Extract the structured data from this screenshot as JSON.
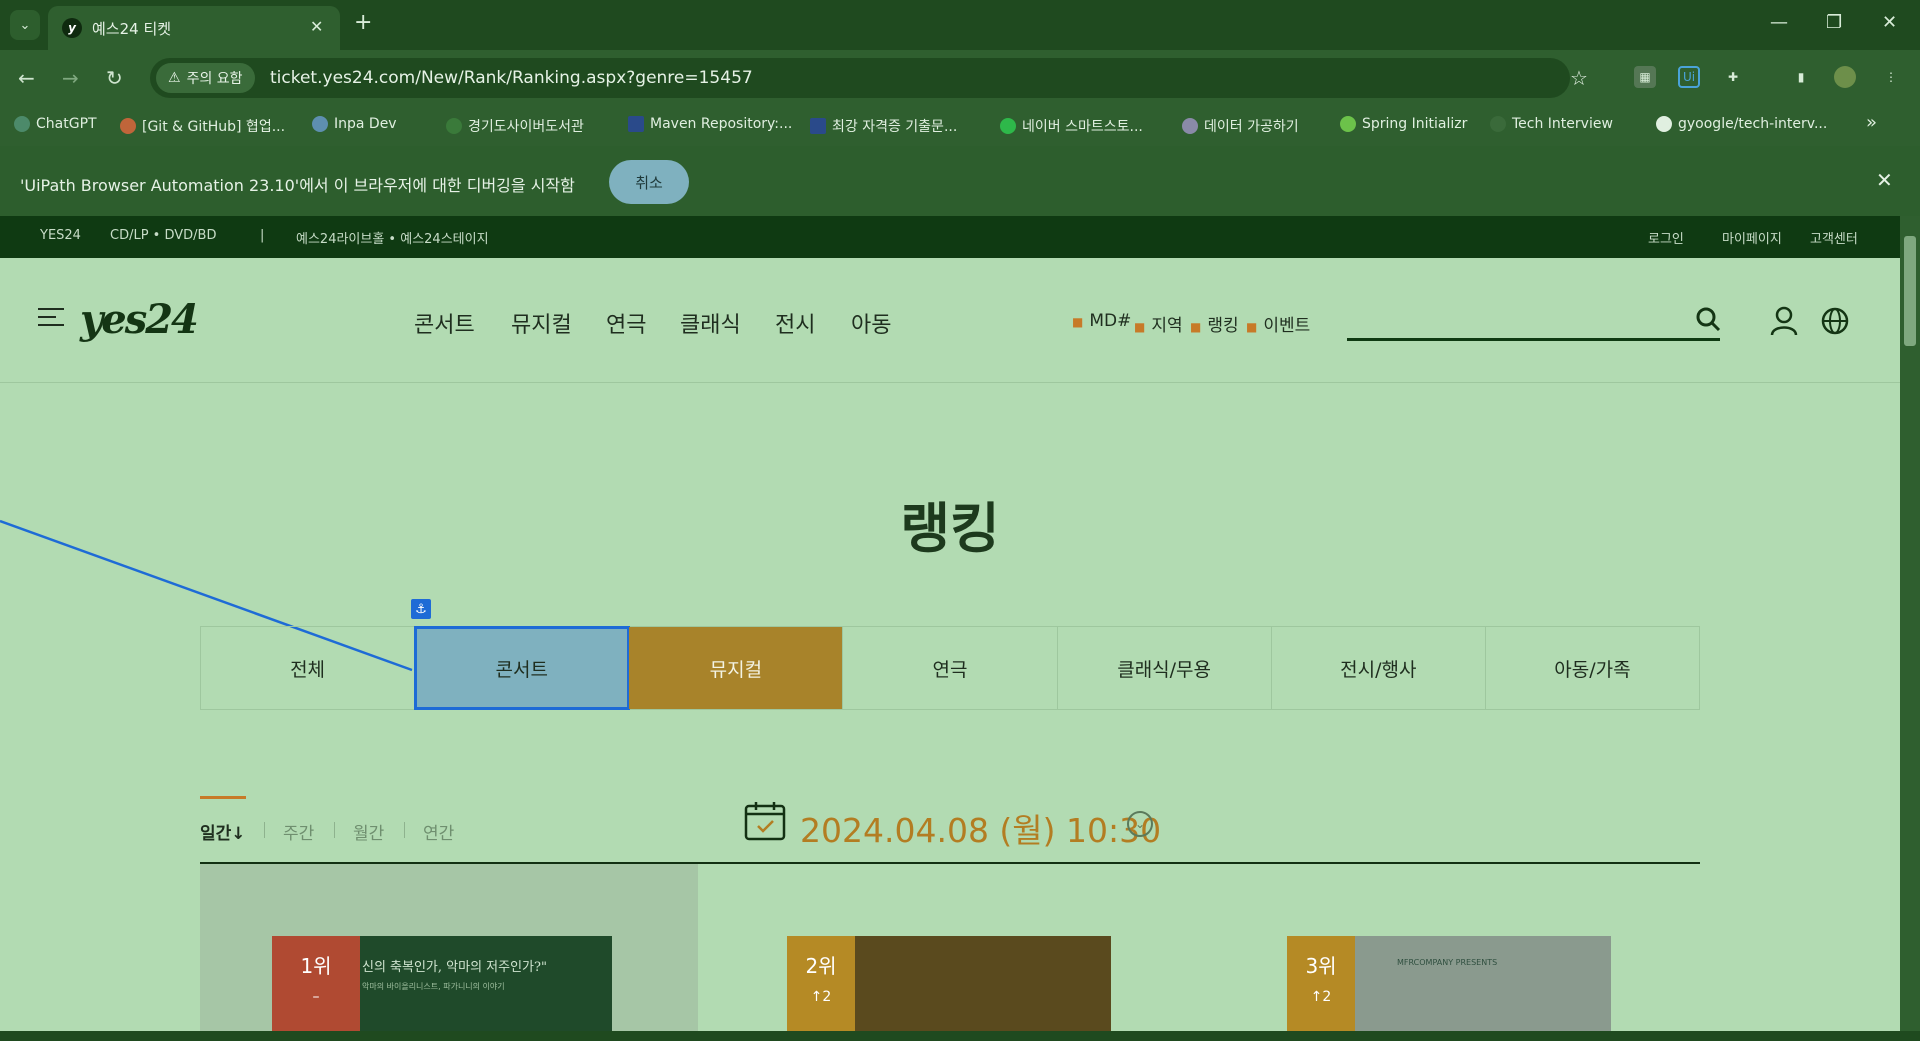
{
  "browser": {
    "tab_title": "예스24 티켓",
    "tab_favicon": "y",
    "tab_close": "✕",
    "new_tab": "+",
    "warning_label": "주의 요함",
    "url": "ticket.yes24.com/New/Rank/Ranking.aspx?genre=15457",
    "bookmarks": [
      {
        "label": "ChatGPT",
        "icon": "chatgpt-icon"
      },
      {
        "label": "[Git & GitHub] 협업...",
        "icon": "git-icon"
      },
      {
        "label": "Inpa Dev",
        "icon": "inpa-icon"
      },
      {
        "label": "경기도사이버도서관",
        "icon": "library-icon"
      },
      {
        "label": "Maven Repository:...",
        "icon": "maven-icon"
      },
      {
        "label": "최강 자격증 기출문...",
        "icon": "gsc-icon"
      },
      {
        "label": "네이버 스마트스토...",
        "icon": "naver-icon"
      },
      {
        "label": "데이터 가공하기",
        "icon": "heart-icon"
      },
      {
        "label": "Spring Initializr",
        "icon": "spring-icon"
      },
      {
        "label": "Tech Interview",
        "icon": "tech-icon"
      },
      {
        "label": "gyoogle/tech-interv...",
        "icon": "github-icon"
      }
    ],
    "bookmarks_more": "»",
    "infobar_text": "'UiPath Browser Automation 23.10'에서 이 브라우저에 대한 디버깅을 시작함",
    "infobar_cancel": "취소",
    "infobar_close": "✕"
  },
  "site": {
    "topstrip": {
      "yes24": "YES24",
      "cdlp": "CD/LP • DVD/BD",
      "divider": "|",
      "live": "예스24라이브홀 • 예스24스테이지",
      "login": "로그인",
      "mypage": "마이페이지",
      "support": "고객센터"
    },
    "logo": "yes24",
    "gnb": [
      "콘서트",
      "뮤지컬",
      "연극",
      "클래식",
      "전시",
      "아동"
    ],
    "sub_links": [
      "MD#",
      "지역",
      "랭킹",
      "이벤트"
    ],
    "ranking_title": "랭킹",
    "categories": [
      {
        "label": "전체",
        "state": "normal"
      },
      {
        "label": "콘서트",
        "state": "highlighted"
      },
      {
        "label": "뮤지컬",
        "state": "active"
      },
      {
        "label": "연극",
        "state": "normal"
      },
      {
        "label": "클래식/무용",
        "state": "normal"
      },
      {
        "label": "전시/행사",
        "state": "normal"
      },
      {
        "label": "아동/가족",
        "state": "normal"
      }
    ],
    "anchor_icon": "⚓",
    "periods": [
      "일간↓",
      "주간",
      "월간",
      "연간"
    ],
    "date": "2024.04.08 (월) 10:30",
    "date_dropdown": "⌄",
    "ranks": [
      {
        "rank": "1위",
        "change": "–",
        "poster_text": "신의 축복인가, 악마의 저주인가?\"",
        "poster_sub": "악마의 바이올리니스트, 파가니니의 이야기"
      },
      {
        "rank": "2위",
        "change": "↑2",
        "poster_text": "",
        "poster_sub": ""
      },
      {
        "rank": "3위",
        "change": "↑2",
        "poster_text": "MFRCOMPANY PRESENTS",
        "poster_sub": ""
      }
    ]
  },
  "colors": {
    "accent_gold": "#a8832a",
    "uipath_blue": "#1e6bd6",
    "highlight_box": "#7fb1bf",
    "rank1": "#b04a32",
    "rank2": "#b58a25",
    "rank3": "#b58a25"
  }
}
